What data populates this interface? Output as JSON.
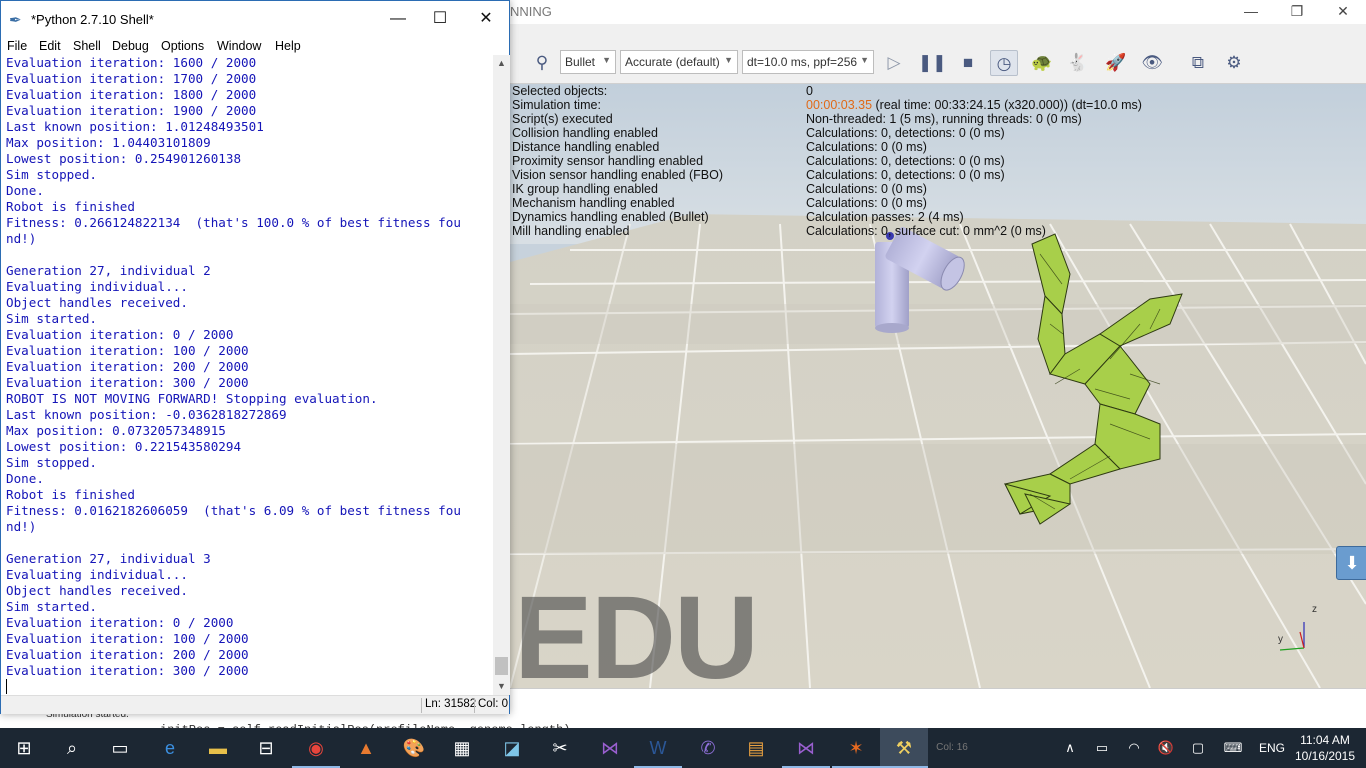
{
  "vrep": {
    "title_fragment": "NNING",
    "win_minimize": "—",
    "win_restore": "❐",
    "win_close": "✕",
    "toolbar": {
      "engine": "Bullet",
      "accuracy": "Accurate (default)",
      "timestep": "dt=10.0 ms, ppf=256"
    },
    "info": [
      {
        "label": "Selected objects:",
        "value": "0"
      },
      {
        "label": "Simulation time:",
        "value": "00:00:03.35",
        "value_rest": " (real time: 00:33:24.15 (x320.000)) (dt=10.0 ms)"
      },
      {
        "label": "Script(s) executed",
        "value": "Non-threaded: 1 (5 ms), running threads: 0 (0 ms)"
      },
      {
        "label": "Collision handling enabled",
        "value": "Calculations: 0, detections: 0 (0 ms)"
      },
      {
        "label": "Distance handling enabled",
        "value": "Calculations: 0 (0 ms)"
      },
      {
        "label": "Proximity sensor handling enabled",
        "value": "Calculations: 0, detections: 0 (0 ms)"
      },
      {
        "label": "Vision sensor handling enabled (FBO)",
        "value": "Calculations: 0, detections: 0 (0 ms)"
      },
      {
        "label": "IK group handling enabled",
        "value": "Calculations: 0 (0 ms)"
      },
      {
        "label": "Mechanism handling enabled",
        "value": "Calculations: 0 (0 ms)"
      },
      {
        "label": "Dynamics handling enabled (Bullet)",
        "value": "Calculation passes: 2 (4 ms)"
      },
      {
        "label": "Mill handling enabled",
        "value": "Calculations: 0, surface cut: 0 mm^2 (0 ms)"
      }
    ],
    "watermark": "EDU",
    "status_text": "Simulation started.",
    "cmd_text": "initPos = self.readInitialPos(profileName, genome.length)",
    "axis_z": "z",
    "axis_y": "y",
    "axis_x": "x"
  },
  "shell": {
    "title": "*Python 2.7.10 Shell*",
    "win_minimize": "—",
    "win_maximize": "☐",
    "win_close": "✕",
    "menu": [
      "File",
      "Edit",
      "Shell",
      "Debug",
      "Options",
      "Window",
      "Help"
    ],
    "lines": [
      "Evaluation iteration: 1600 / 2000",
      "Evaluation iteration: 1700 / 2000",
      "Evaluation iteration: 1800 / 2000",
      "Evaluation iteration: 1900 / 2000",
      "Last known position: 1.01248493501",
      "Max position: 1.04403101809",
      "Lowest position: 0.254901260138",
      "Sim stopped.",
      "Done.",
      "Robot is finished",
      "Fitness: 0.266124822134  (that's 100.0 % of best fitness fou",
      "nd!)",
      "",
      "Generation 27, individual 2",
      "Evaluating individual...",
      "Object handles received.",
      "Sim started.",
      "Evaluation iteration: 0 / 2000",
      "Evaluation iteration: 100 / 2000",
      "Evaluation iteration: 200 / 2000",
      "Evaluation iteration: 300 / 2000",
      "ROBOT IS NOT MOVING FORWARD! Stopping evaluation.",
      "Last known position: -0.0362818272869",
      "Max position: 0.0732057348915",
      "Lowest position: 0.221543580294",
      "Sim stopped.",
      "Done.",
      "Robot is finished",
      "Fitness: 0.0162182606059  (that's 6.09 % of best fitness fou",
      "nd!)",
      "",
      "Generation 27, individual 3",
      "Evaluating individual...",
      "Object handles received.",
      "Sim started.",
      "Evaluation iteration: 0 / 2000",
      "Evaluation iteration: 100 / 2000",
      "Evaluation iteration: 200 / 2000",
      "Evaluation iteration: 300 / 2000"
    ],
    "status_ln": "Ln: 31582",
    "status_col": "Col: 0",
    "scroll_up": "▲",
    "scroll_down": "▼"
  },
  "taskbar": {
    "language": "ENG",
    "time": "11:04 AM",
    "date": "10/16/2015",
    "col_fragment": "Col: 16"
  },
  "icons": {
    "start": "start-icon",
    "search": "search-icon",
    "taskview": "task-view-icon"
  }
}
